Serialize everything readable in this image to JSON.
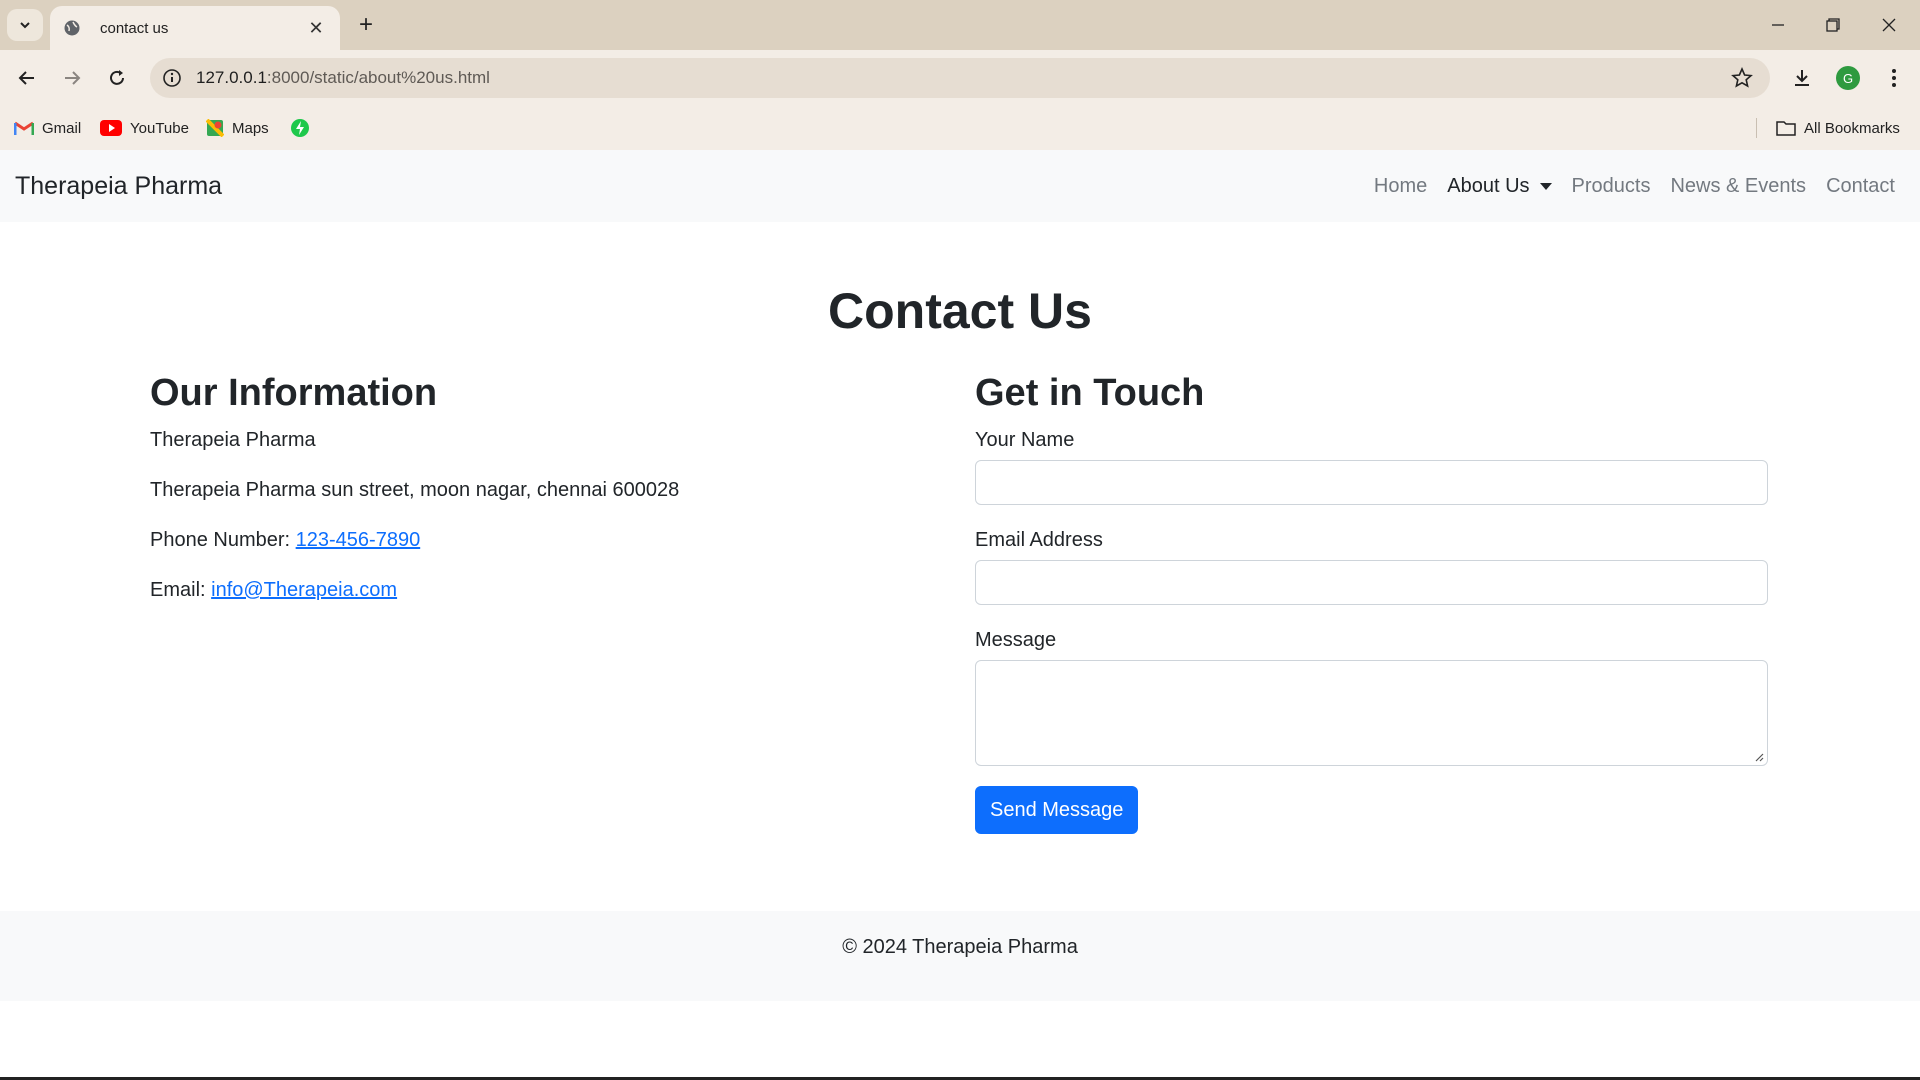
{
  "browser": {
    "tab_title": "contact us",
    "url_host": "127.0.0.1",
    "url_rest": ":8000/static/about%20us.html",
    "profile_initial": "G",
    "bookmarks": [
      {
        "label": "Gmail",
        "icon": "gmail-icon"
      },
      {
        "label": "YouTube",
        "icon": "youtube-icon"
      },
      {
        "label": "Maps",
        "icon": "maps-icon"
      },
      {
        "label": "",
        "icon": "green-extension-icon"
      }
    ],
    "all_bookmarks": "All Bookmarks"
  },
  "nav": {
    "brand": "Therapeia Pharma",
    "links": [
      "Home",
      "About Us",
      "Products",
      "News & Events",
      "Contact"
    ]
  },
  "page": {
    "title": "Contact Us",
    "info": {
      "heading": "Our Information",
      "company": "Therapeia Pharma",
      "address": "Therapeia Pharma sun street, moon nagar, chennai 600028",
      "phone_label": "Phone Number: ",
      "phone": "123-456-7890",
      "email_label": "Email: ",
      "email": "info@Therapeia.com"
    },
    "form": {
      "heading": "Get in Touch",
      "name_label": "Your Name",
      "email_label": "Email Address",
      "message_label": "Message",
      "submit": "Send Message"
    }
  },
  "footer": {
    "text": "© 2024 Therapeia Pharma"
  },
  "colors": {
    "primary": "#0d6efd",
    "navbar_bg": "#f8f9fa",
    "chrome_tabbar": "#dcd1c0"
  }
}
